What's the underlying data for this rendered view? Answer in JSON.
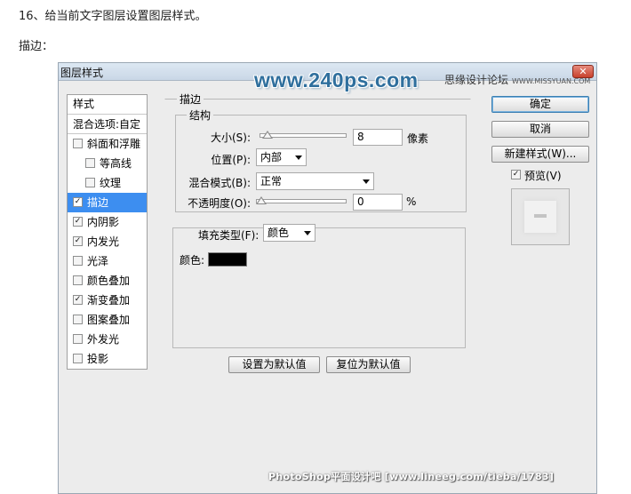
{
  "article": {
    "step_text": "16、给当前文字图层设置图层样式。",
    "section_label": "描边："
  },
  "dialog": {
    "title": "图层样式",
    "close_glyph": "✕",
    "watermark_logo": "www.240ps.com",
    "watermark_site": "思缘设计论坛",
    "watermark_site_url": "WWW.MISSYUAN.COM",
    "footer_watermark": "PhotoShop平面设计吧 [www.lineeg.com/tieba/1783]"
  },
  "styles_panel": {
    "header": "样式",
    "blend_options": "混合选项:自定",
    "items": [
      {
        "label": "斜面和浮雕",
        "checked": false,
        "sub": false,
        "selected": false
      },
      {
        "label": "等高线",
        "checked": false,
        "sub": true,
        "selected": false
      },
      {
        "label": "纹理",
        "checked": false,
        "sub": true,
        "selected": false
      },
      {
        "label": "描边",
        "checked": true,
        "sub": false,
        "selected": true
      },
      {
        "label": "内阴影",
        "checked": true,
        "sub": false,
        "selected": false
      },
      {
        "label": "内发光",
        "checked": true,
        "sub": false,
        "selected": false
      },
      {
        "label": "光泽",
        "checked": false,
        "sub": false,
        "selected": false
      },
      {
        "label": "颜色叠加",
        "checked": false,
        "sub": false,
        "selected": false
      },
      {
        "label": "渐变叠加",
        "checked": true,
        "sub": false,
        "selected": false
      },
      {
        "label": "图案叠加",
        "checked": false,
        "sub": false,
        "selected": false
      },
      {
        "label": "外发光",
        "checked": false,
        "sub": false,
        "selected": false
      },
      {
        "label": "投影",
        "checked": false,
        "sub": false,
        "selected": false
      }
    ]
  },
  "stroke": {
    "group_title": "描边",
    "structure_title": "结构",
    "size_label": "大小(S):",
    "size_value": "8",
    "size_unit": "像素",
    "size_slider_fraction": 0.03,
    "position_label": "位置(P):",
    "position_value": "内部",
    "blend_mode_label": "混合模式(B):",
    "blend_mode_value": "正常",
    "opacity_label": "不透明度(O):",
    "opacity_value": "0",
    "opacity_unit": "%",
    "opacity_slider_fraction": 0.0,
    "fill_type_label": "填充类型(F):",
    "fill_type_value": "颜色",
    "color_label": "颜色:",
    "color_value": "#000000",
    "make_default_button": "设置为默认值",
    "reset_default_button": "复位为默认值"
  },
  "actions": {
    "ok_button": "确定",
    "cancel_button": "取消",
    "new_style_button": "新建样式(W)...",
    "preview_label": "预览(V)",
    "preview_checked": true
  },
  "icons": {
    "check_glyph": "✓",
    "dropdown": "chevron-down-icon",
    "slider_thumb": "triangle-thumb-icon"
  }
}
